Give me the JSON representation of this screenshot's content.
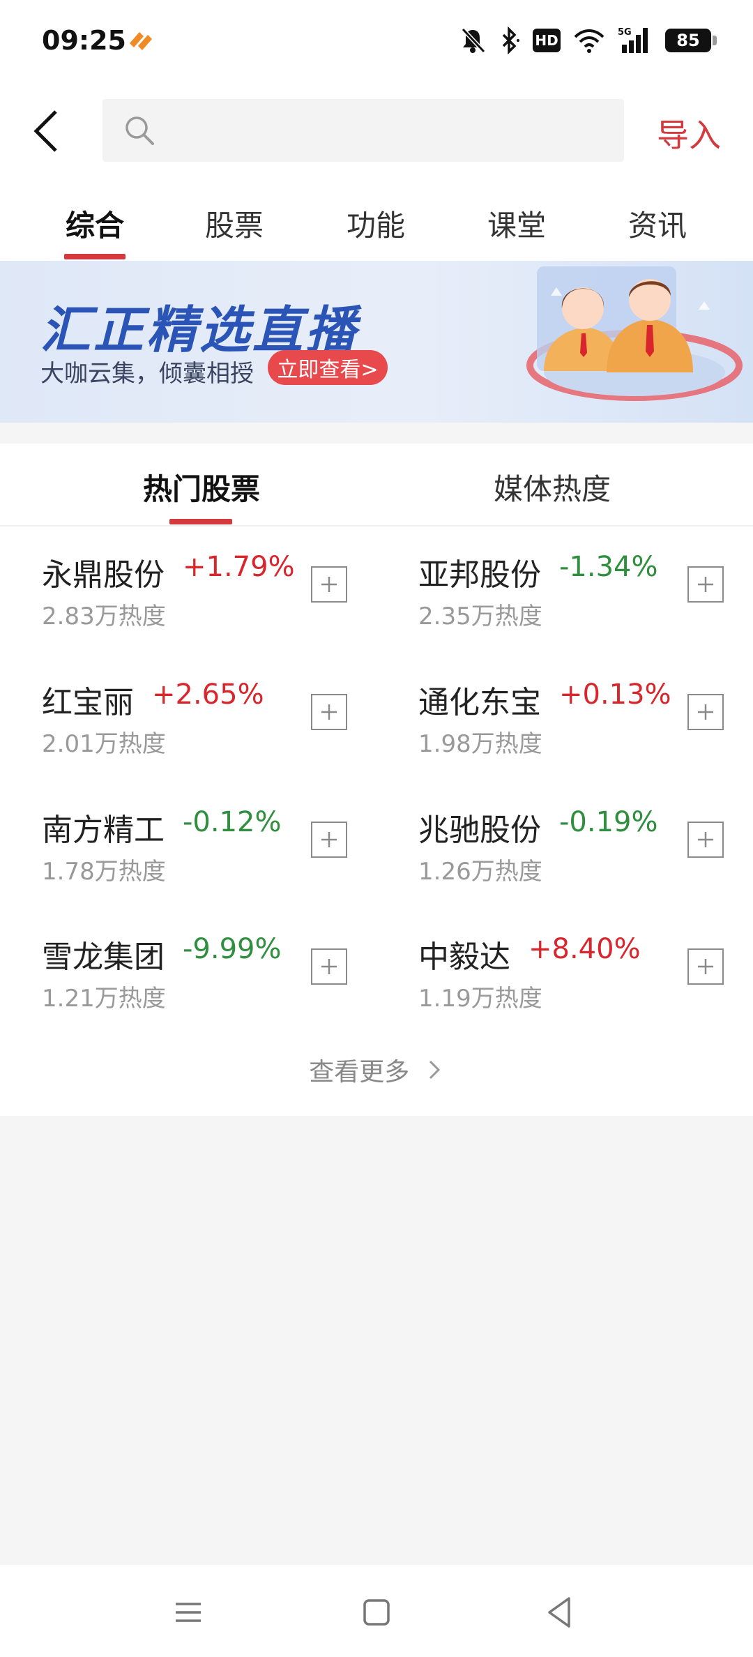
{
  "status_bar": {
    "time": "09:25",
    "icons": [
      "app-notification-icon",
      "mute-icon",
      "bluetooth-icon",
      "hd-icon",
      "wifi-icon",
      "signal-5g-icon",
      "battery-icon"
    ],
    "hd_label": "HD",
    "network_label": "5G",
    "battery_level": "85"
  },
  "header": {
    "search_placeholder": "",
    "search_value": "",
    "import_label": "导入"
  },
  "category_tabs": [
    {
      "label": "综合",
      "active": true
    },
    {
      "label": "股票",
      "active": false
    },
    {
      "label": "功能",
      "active": false
    },
    {
      "label": "课堂",
      "active": false
    },
    {
      "label": "资讯",
      "active": false
    }
  ],
  "banner": {
    "title": "汇正精选直播",
    "subtitle": "大咖云集，倾囊相授",
    "cta_label": "立即查看>"
  },
  "hot_section": {
    "tabs": [
      {
        "label": "热门股票",
        "active": true
      },
      {
        "label": "媒体热度",
        "active": false
      }
    ],
    "stocks": [
      {
        "name": "永鼎股份",
        "change": "+1.79%",
        "direction": "up",
        "heat": "2.83万热度"
      },
      {
        "name": "亚邦股份",
        "change": "-1.34%",
        "direction": "down",
        "heat": "2.35万热度"
      },
      {
        "name": "红宝丽",
        "change": "+2.65%",
        "direction": "up",
        "heat": "2.01万热度"
      },
      {
        "name": "通化东宝",
        "change": "+0.13%",
        "direction": "up",
        "heat": "1.98万热度"
      },
      {
        "name": "南方精工",
        "change": "-0.12%",
        "direction": "down",
        "heat": "1.78万热度"
      },
      {
        "name": "兆驰股份",
        "change": "-0.19%",
        "direction": "down",
        "heat": "1.26万热度"
      },
      {
        "name": "雪龙集团",
        "change": "-9.99%",
        "direction": "down",
        "heat": "1.21万热度"
      },
      {
        "name": "中毅达",
        "change": "+8.40%",
        "direction": "up",
        "heat": "1.19万热度"
      }
    ],
    "more_label": "查看更多"
  },
  "colors": {
    "accent": "#d3393d",
    "up": "#d9262c",
    "down": "#2f8f3e",
    "banner_title": "#2a55b7"
  },
  "nav_bar": {
    "buttons": [
      "menu-icon",
      "home-icon",
      "back-triangle-icon"
    ]
  }
}
